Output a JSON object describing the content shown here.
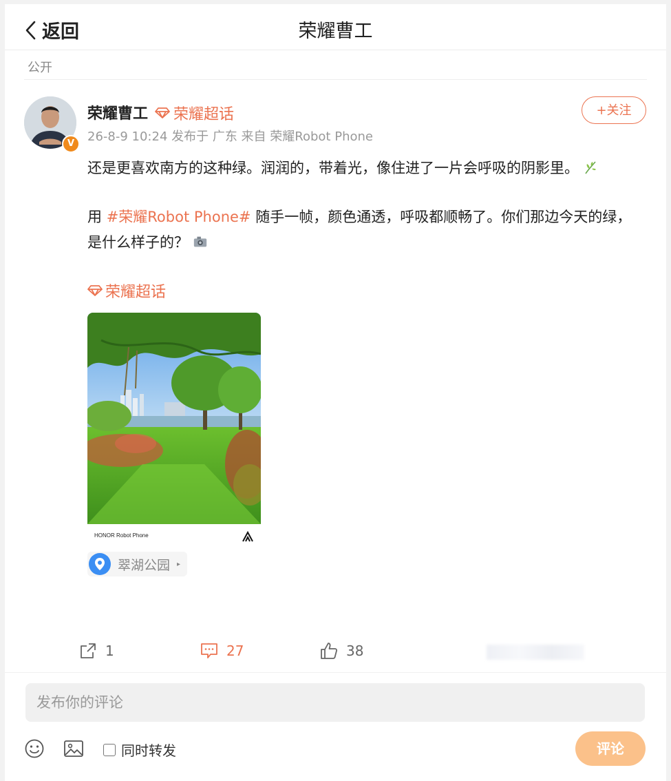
{
  "header": {
    "back_label": "返回",
    "title": "荣耀曹工"
  },
  "visibility": "公开",
  "author": {
    "name": "荣耀曹工",
    "topic_tag": "荣耀超话",
    "verified_badge": "V",
    "meta": "26-8-9 10:24 发布于 广东 来自 荣耀Robot Phone",
    "follow_label": "+关注"
  },
  "post": {
    "line1": "还是更喜欢南方的这种绿。润润的，带着光，像住进了一片会呼吸的阴影里。",
    "line2_prefix": "用 ",
    "hashtag": "#荣耀Robot Phone#",
    "line2_rest": " 随手一帧，颜色通透，呼吸都顺畅了。你们那边今天的绿，是什么样子的？",
    "topic_link": "荣耀超话"
  },
  "photo": {
    "watermark": "HONOR Robot Phone"
  },
  "location": {
    "label": "翠湖公园"
  },
  "actions": {
    "share_count": "1",
    "comment_count": "27",
    "like_count": "38"
  },
  "composer": {
    "placeholder": "发布你的评论",
    "repost_label": "同时转发",
    "submit_label": "评论"
  },
  "colors": {
    "accent": "#eb7350",
    "submit_bg": "#fbc18a",
    "location_pin": "#3b8ef3"
  },
  "icons": [
    "chevron-left-icon",
    "diamond-icon",
    "plant-sticker-icon",
    "camera-sticker-icon",
    "location-pin-icon",
    "share-icon",
    "comment-icon",
    "like-icon",
    "emoji-icon",
    "image-icon"
  ]
}
